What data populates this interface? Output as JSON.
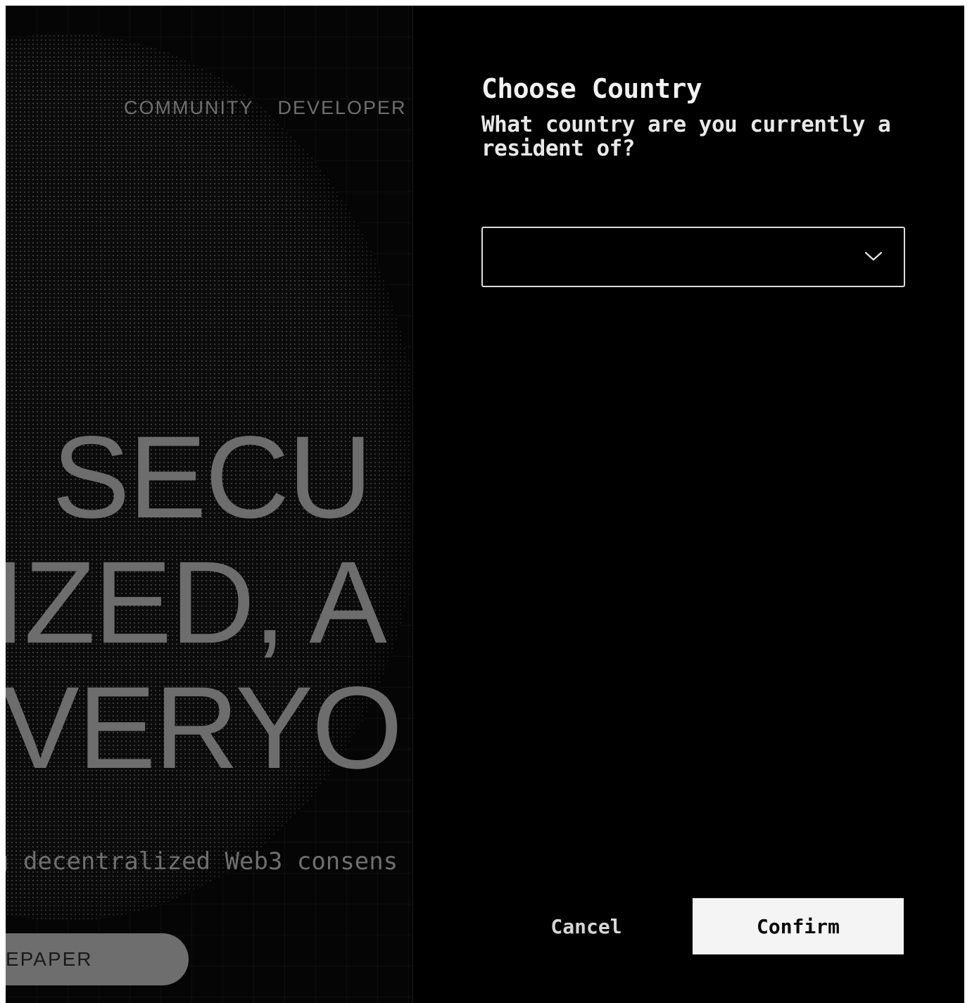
{
  "background_page": {
    "nav": {
      "community": "COMMUNITY",
      "developers": "DEVELOPER"
    },
    "hero": {
      "line1": "SECU",
      "line2": "IZED, A",
      "line3": "VERYO"
    },
    "tagline": "g decentralized Web3 consens",
    "whitepaper_button": "EPAPER"
  },
  "modal": {
    "title": "Choose Country",
    "subtitle": "What country are you currently a resident of?",
    "select": {
      "value": "",
      "icon": "chevron-down-icon"
    },
    "cancel_label": "Cancel",
    "confirm_label": "Confirm"
  },
  "colors": {
    "background": "#000000",
    "modal_text": "#f2f2f2",
    "muted_text": "#6f6f6f",
    "confirm_bg": "#f4f4f4"
  }
}
